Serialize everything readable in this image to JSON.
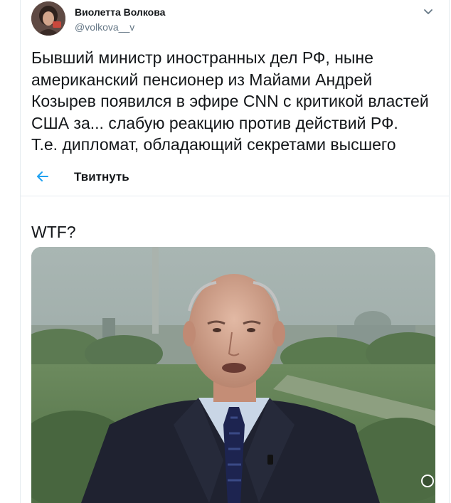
{
  "user": {
    "display_name": "Виолетта Волкова",
    "handle": "@volkova__v"
  },
  "tweet": {
    "lines": [
      "Бывший министр иностранных дел РФ, ныне",
      "американский пенсионер из Майами Андрей",
      "Козырев появился в эфире CNN с критикой властей",
      "США за... слабую реакцию против действий РФ.",
      "Т.е. дипломат, обладающий секретами высшего"
    ],
    "continuation": "WTF?"
  },
  "subnav": {
    "title": "Твитнуть"
  },
  "icons": {
    "back": "arrow-left-icon",
    "caret": "chevron-down-icon"
  },
  "colors": {
    "accent": "#1da1f2",
    "text": "#14171a",
    "secondary": "#657786",
    "border": "#e6ecf0"
  }
}
